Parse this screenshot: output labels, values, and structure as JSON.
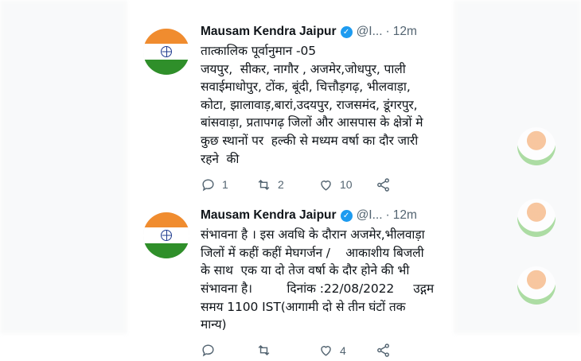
{
  "tweets": [
    {
      "author": "Mausam Kendra Jaipur",
      "handle": "@I...",
      "time": "12m",
      "text": "तात्कालिक पूर्वानुमान -05\nजयपुर,  सीकर, नागौर , अजमेर,जोधपुर, पाली\nसवाईमाधोपुर, टोंक, बूंदी, चित्तौड़गढ़, भीलवाड़ा,\nकोटा, झालावाड़,बारां,उदयपुर, राजसमंद, डूंगरपुर,\nबांसवाड़ा, प्रतापगढ़ जिलों और आसपास के क्षेत्रों मे\nकुछ स्थानों पर  हल्की से मध्यम वर्षा का दौर जारी\nरहने  की",
      "reply_count": "1",
      "retweet_count": "2",
      "like_count": "10"
    },
    {
      "author": "Mausam Kendra Jaipur",
      "handle": "@I...",
      "time": "12m",
      "text": "संभावना है । इस अवधि के दौरान अजमेर,भीलवाड़ा\nजिलों में कहीं कहीं मेघगर्जन /    आकाशीय बिजली\nके साथ  एक या दो तेज वर्षा के दौर होने की भी\nसंभावना है।         दिनांक :22/08/2022     उद्गम\nसमय 1100 IST(आगामी दो से तीन घंटों तक\nमान्य)",
      "reply_count": "",
      "retweet_count": "",
      "like_count": "4"
    }
  ],
  "icons": {
    "reply": "reply-icon",
    "retweet": "retweet-icon",
    "like": "heart-icon",
    "share": "share-icon",
    "verified": "verified-badge-icon"
  },
  "colors": {
    "verified": "#1d9bf0",
    "muted": "#536471",
    "text": "#0f1419"
  }
}
